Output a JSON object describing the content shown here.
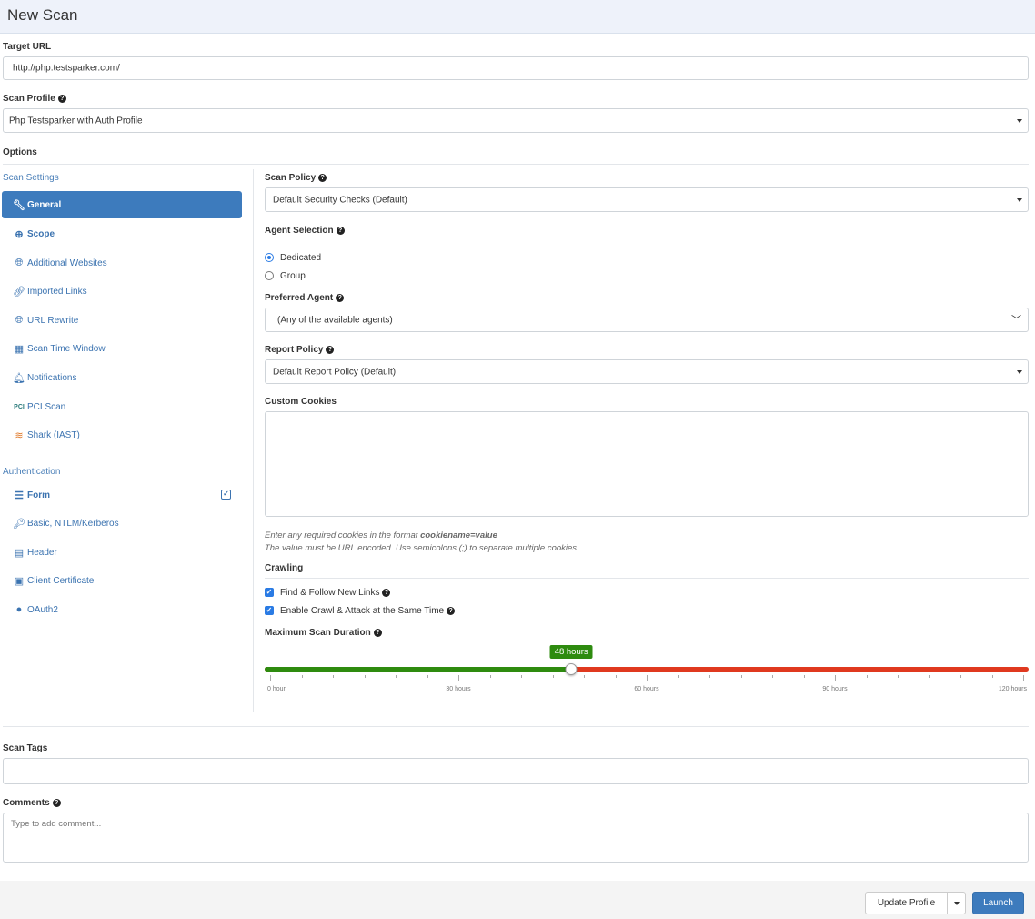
{
  "page": {
    "title": "New Scan"
  },
  "target_url": {
    "label": "Target URL",
    "value": "http://php.testsparker.com/"
  },
  "scan_profile": {
    "label": "Scan Profile",
    "value": "Php Testsparker with Auth Profile"
  },
  "options_label": "Options",
  "sidebar": {
    "scan_settings_title": "Scan Settings",
    "items": [
      {
        "label": "General",
        "icon": "wrench-icon"
      },
      {
        "label": "Scope",
        "icon": "crosshair-icon"
      },
      {
        "label": "Additional Websites",
        "icon": "globe-icon"
      },
      {
        "label": "Imported Links",
        "icon": "link-icon"
      },
      {
        "label": "URL Rewrite",
        "icon": "globe-icon"
      },
      {
        "label": "Scan Time Window",
        "icon": "calendar-icon"
      },
      {
        "label": "Notifications",
        "icon": "bell-icon"
      },
      {
        "label": "PCI Scan",
        "icon": "pci-icon"
      },
      {
        "label": "Shark (IAST)",
        "icon": "shark-icon"
      }
    ],
    "authentication_title": "Authentication",
    "auth_items": [
      {
        "label": "Form",
        "icon": "form-icon"
      },
      {
        "label": "Basic, NTLM/Kerberos",
        "icon": "key-icon"
      },
      {
        "label": "Header",
        "icon": "header-icon"
      },
      {
        "label": "Client Certificate",
        "icon": "certificate-icon"
      },
      {
        "label": "OAuth2",
        "icon": "oauth-icon"
      }
    ]
  },
  "scan_policy": {
    "label": "Scan Policy",
    "value": "Default Security Checks (Default)"
  },
  "agent_selection": {
    "label": "Agent Selection",
    "options": [
      "Dedicated",
      "Group"
    ],
    "selected": "Dedicated"
  },
  "preferred_agent": {
    "label": "Preferred Agent",
    "value": "(Any of the available agents)"
  },
  "report_policy": {
    "label": "Report Policy",
    "value": "Default Report Policy (Default)"
  },
  "custom_cookies": {
    "label": "Custom Cookies",
    "note_prefix": "Enter any required cookies in the format ",
    "note_format": "cookiename=value",
    "note_line2": "The value must be URL encoded. Use semicolons (;) to separate multiple cookies."
  },
  "crawling": {
    "label": "Crawling",
    "find_follow": "Find & Follow New Links",
    "crawl_attack": "Enable Crawl & Attack at the Same Time"
  },
  "max_duration": {
    "label": "Maximum Scan Duration",
    "value_hours": 48,
    "value_label": "48 hours",
    "min": 0,
    "max": 120,
    "tick_labels": [
      "0 hour",
      "30 hours",
      "60 hours",
      "90 hours",
      "120 hours"
    ],
    "colors": {
      "filled": "#2e8b0f",
      "remaining": "#e0391f",
      "badge": "#2e8b0f"
    }
  },
  "scan_tags": {
    "label": "Scan Tags",
    "value": ""
  },
  "comments": {
    "label": "Comments",
    "placeholder": "Type to add comment..."
  },
  "footer": {
    "update_profile": "Update Profile",
    "launch": "Launch"
  },
  "colors": {
    "accent": "#3d7bbd",
    "link": "#3b73b0",
    "header_bg": "#eef2fa"
  }
}
